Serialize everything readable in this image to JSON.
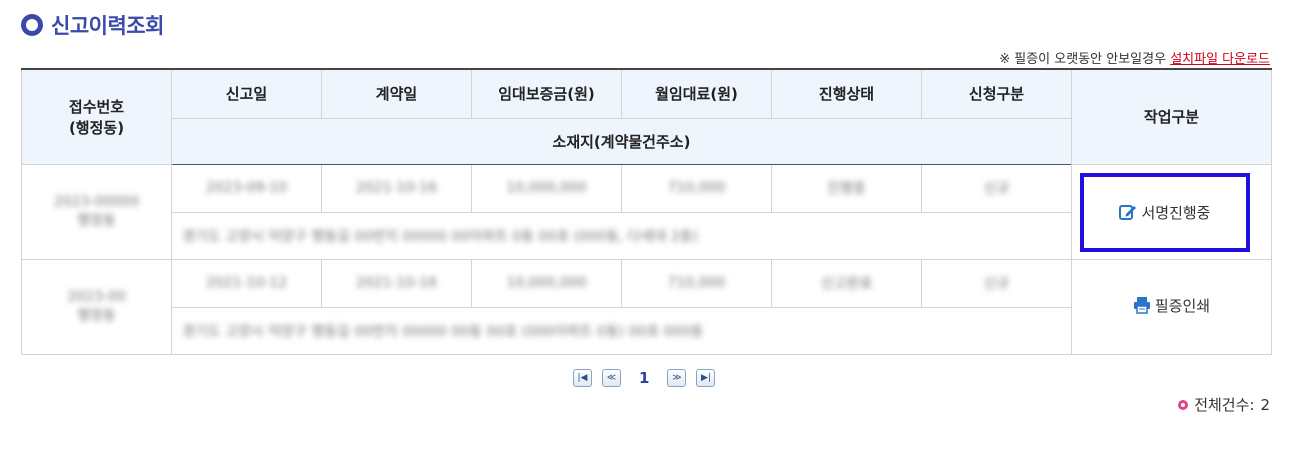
{
  "page": {
    "title": "신고이력조회",
    "notice": {
      "prefix": "※ 필증이 오랫동안 안보일경우 ",
      "link": "설치파일 다운로드"
    }
  },
  "table": {
    "headers": {
      "receipt_no": "접수번호",
      "receipt_no_sub": "(행정동)",
      "report_date": "신고일",
      "contract_date": "계약일",
      "deposit": "임대보증금(원)",
      "monthly_rent": "월임대료(원)",
      "progress": "진행상태",
      "request_type": "신청구분",
      "address": "소재지(계약물건주소)",
      "action": "작업구분"
    },
    "rows": [
      {
        "receipt_no": "2023-00000",
        "dong": "행정동",
        "report_date": "2023-09-10",
        "contract_date": "2021-10-16",
        "deposit": "10,000,000",
        "monthly_rent": "710,000",
        "status": "진행중",
        "type": "신규",
        "address": "경기도 고양시 덕양구 행동길 00번지 00000 00아파트 0동 00호 (000동, 다세대 2층)",
        "action": "서명진행중"
      },
      {
        "receipt_no": "2023-00",
        "dong": "행정동",
        "report_date": "2021-10-12",
        "contract_date": "2021-10-16",
        "deposit": "10,000,000",
        "monthly_rent": "710,000",
        "status": "신고완료",
        "type": "신규",
        "address": "경기도 고양시 덕양구 행동길 00번지 00000 00동 00호 (000아파트 0동) 00호 000동",
        "action": "필증인쇄"
      }
    ]
  },
  "pagination": {
    "first": "|◀",
    "prev": "≪",
    "current": "1",
    "next": "≫",
    "last": "▶|"
  },
  "summary": {
    "total_label": "전체건수:",
    "total_count": "2"
  },
  "colors": {
    "accent": "#3b4aa8",
    "header_bg": "#eef5fc",
    "selection": "#1f10e0",
    "link": "#d0021b",
    "bullet": "#e0438b"
  },
  "icons": {
    "title": "ring-bullet-icon",
    "sign": "edit-pen-icon",
    "print": "printer-icon",
    "bullet": "pink-dot-icon"
  }
}
